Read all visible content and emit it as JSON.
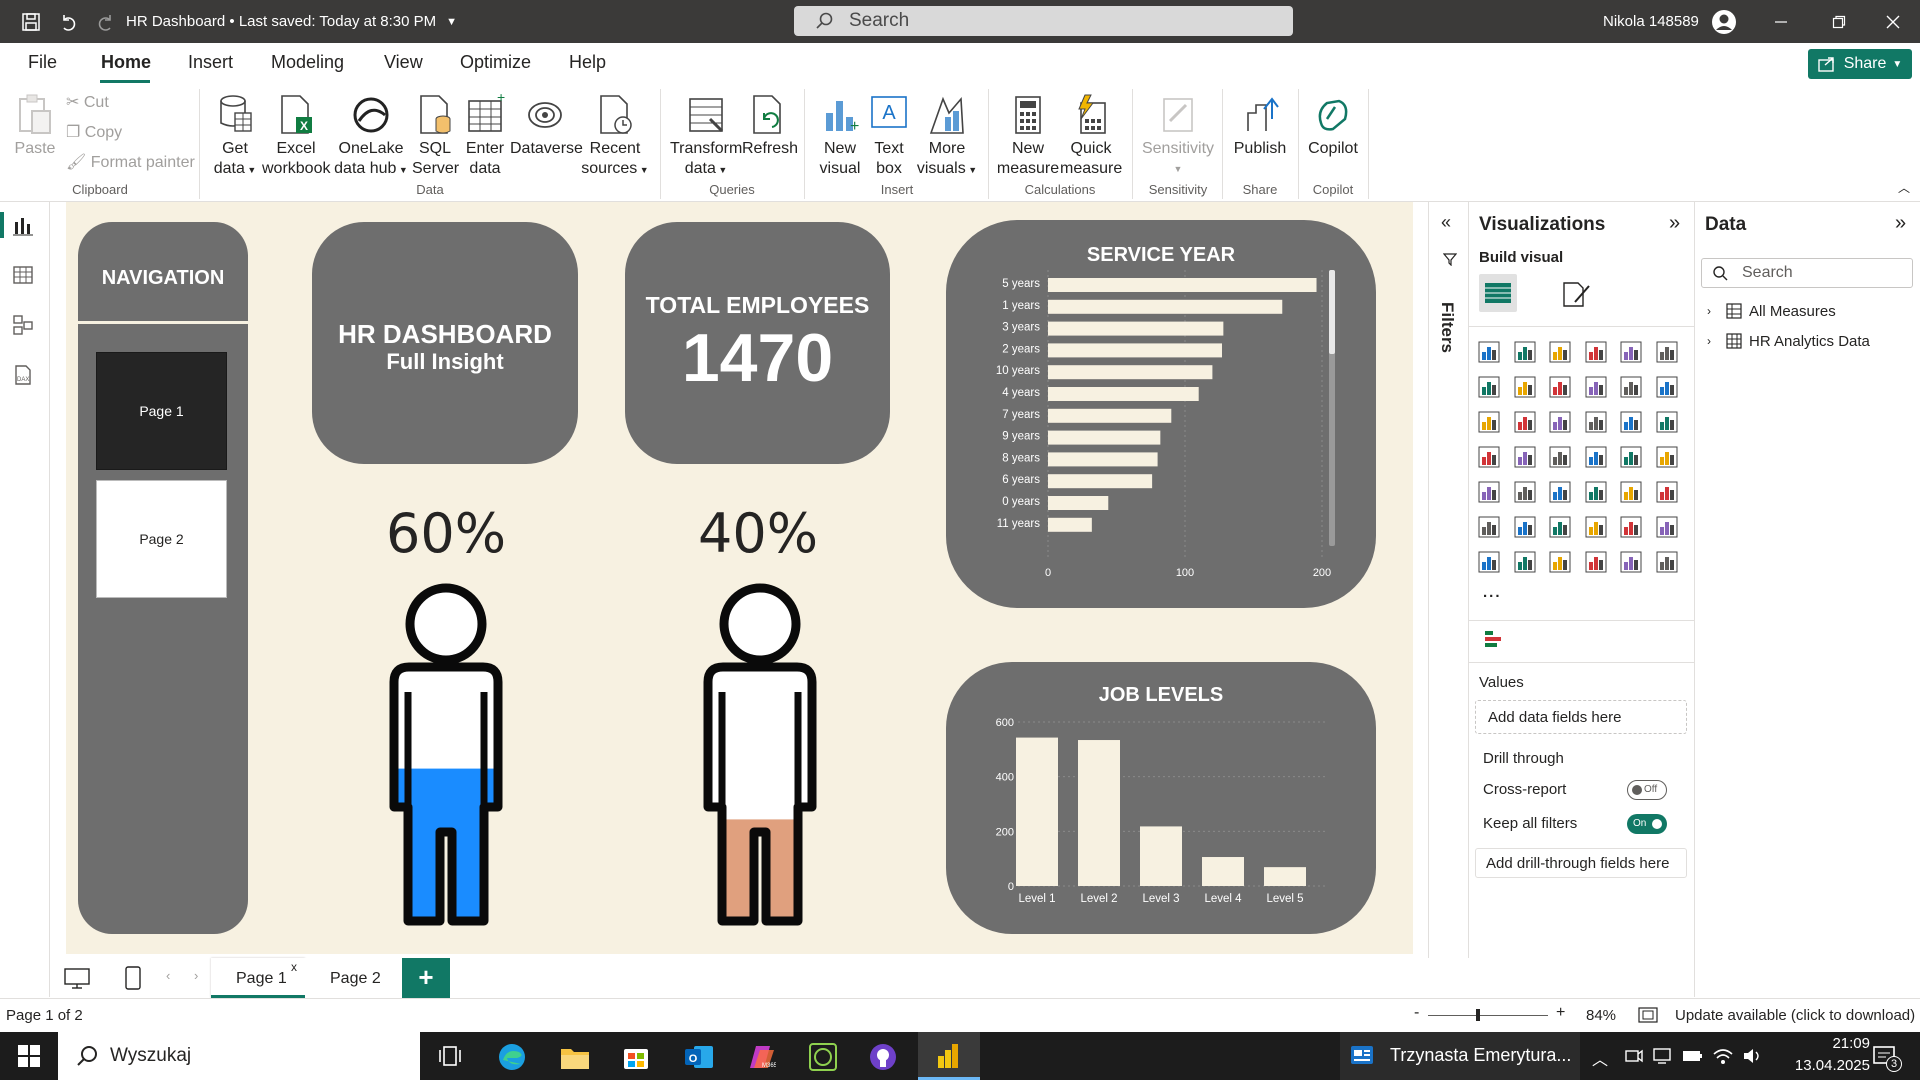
{
  "titlebar": {
    "title": "HR Dashboard",
    "saved": "Last saved: Today at 8:30 PM",
    "search_placeholder": "Search",
    "user": "Nikola 148589"
  },
  "menu": {
    "items": [
      "File",
      "Home",
      "Insert",
      "Modeling",
      "View",
      "Optimize",
      "Help"
    ],
    "active": "Home",
    "share_label": "Share"
  },
  "ribbon": {
    "clipboard": {
      "paste": "Paste",
      "cut": "Cut",
      "copy": "Copy",
      "format_painter": "Format painter",
      "group": "Clipboard"
    },
    "data": {
      "get_data": [
        "Get",
        "data"
      ],
      "excel": [
        "Excel",
        "workbook"
      ],
      "onelake": [
        "OneLake",
        "data hub"
      ],
      "sql": [
        "SQL",
        "Server"
      ],
      "enter": [
        "Enter",
        "data"
      ],
      "dataverse": "Dataverse",
      "recent": [
        "Recent",
        "sources"
      ],
      "group": "Data"
    },
    "queries": {
      "transform": [
        "Transform",
        "data"
      ],
      "refresh": "Refresh",
      "group": "Queries"
    },
    "insert": {
      "new_visual": [
        "New",
        "visual"
      ],
      "text_box": [
        "Text",
        "box"
      ],
      "more_visuals": [
        "More",
        "visuals"
      ],
      "group": "Insert"
    },
    "calculations": {
      "new_measure": [
        "New",
        "measure"
      ],
      "quick_measure": [
        "Quick",
        "measure"
      ],
      "group": "Calculations"
    },
    "sensitivity": {
      "label": "Sensitivity",
      "group": "Sensitivity"
    },
    "share": {
      "publish": "Publish",
      "group": "Share"
    },
    "copilot": {
      "label": "Copilot",
      "group": "Copilot"
    }
  },
  "report": {
    "navigation": {
      "title": "NAVIGATION",
      "page1": "Page 1",
      "page2": "Page 2"
    },
    "header": {
      "title": "HR DASHBOARD",
      "subtitle": "Full Insight"
    },
    "total": {
      "label": "TOTAL EMPLOYEES",
      "value": "1470"
    },
    "male_pct": "60%",
    "female_pct": "40%",
    "gauges": {
      "male_fill": 0.6,
      "female_fill": 0.4,
      "male_color": "#1a8cff",
      "female_color": "#e0a07e"
    }
  },
  "chart_data": [
    {
      "type": "bar",
      "orientation": "horizontal",
      "title": "SERVICE YEAR",
      "categories": [
        "5 years",
        "1 years",
        "3 years",
        "2 years",
        "10 years",
        "4 years",
        "7 years",
        "9 years",
        "8 years",
        "6 years",
        "0 years",
        "11 years"
      ],
      "values": [
        196,
        171,
        128,
        127,
        120,
        110,
        90,
        82,
        80,
        76,
        44,
        32
      ],
      "xlim": [
        0,
        200
      ],
      "xticks": [
        "0",
        "100",
        "200"
      ],
      "grid": true
    },
    {
      "type": "bar",
      "title": "JOB LEVELS",
      "categories": [
        "Level 1",
        "Level 2",
        "Level 3",
        "Level 4",
        "Level 5"
      ],
      "values": [
        543,
        534,
        218,
        106,
        69
      ],
      "ylim": [
        0,
        600
      ],
      "yticks": [
        "0",
        "200",
        "400",
        "600"
      ],
      "grid": true
    }
  ],
  "filters": {
    "label": "Filters"
  },
  "visualizations": {
    "title": "Visualizations",
    "build_visual": "Build visual",
    "values_label": "Values",
    "add_data": "Add data fields here",
    "drill_through": "Drill through",
    "cross_report": "Cross-report",
    "cross_report_state": "Off",
    "keep_filters": "Keep all filters",
    "keep_filters_state": "On",
    "add_drill": "Add drill-through fields here",
    "more": "..."
  },
  "data_pane": {
    "title": "Data",
    "search_placeholder": "Search",
    "items": [
      "All Measures",
      "HR Analytics Data"
    ]
  },
  "page_tabs": {
    "tabs": [
      "Page 1",
      "Page 2"
    ],
    "active": "Page 1",
    "close": "x",
    "add": "+"
  },
  "status": {
    "page": "Page 1 of 2",
    "zoom": "84%",
    "update": "Update available (click to download)",
    "zoom_minus": "-",
    "zoom_plus": "+"
  },
  "taskbar": {
    "search": "Wyszukaj",
    "news": "Trzynasta Emerytura...",
    "time": "21:09",
    "date": "13.04.2025",
    "notifications": "3"
  }
}
